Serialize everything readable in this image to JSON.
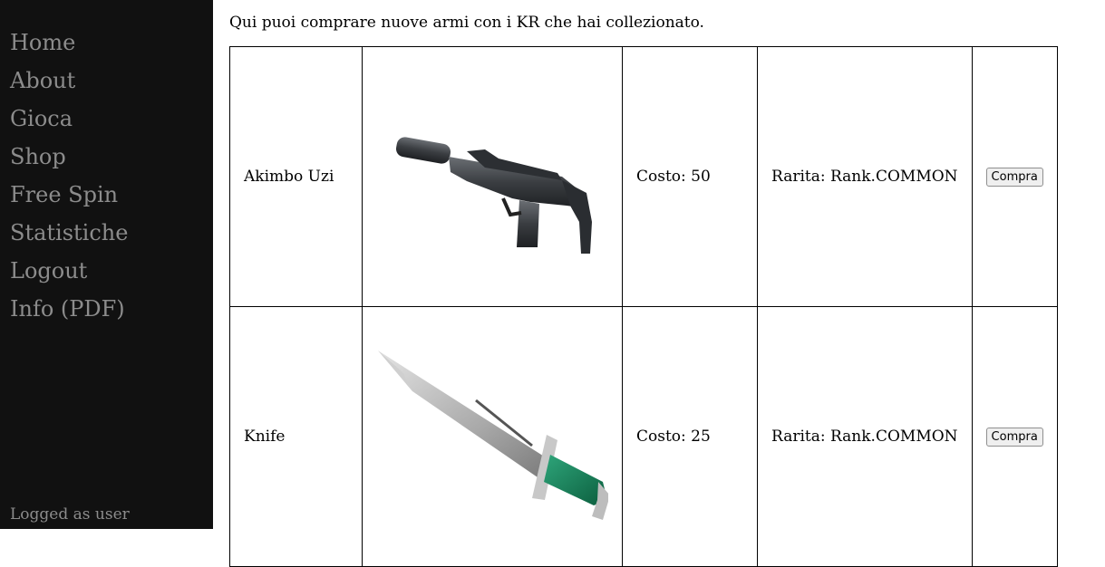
{
  "nav": {
    "items": [
      "Home",
      "About",
      "Gioca",
      "Shop",
      "Free Spin",
      "Statistiche",
      "Logout",
      "Info (PDF)"
    ],
    "logged_as": "Logged as user"
  },
  "intro": "Qui puoi comprare nuove armi con i KR che hai collezionato.",
  "weapons": [
    {
      "name": "Akimbo Uzi",
      "cost": "Costo: 50",
      "rarity": "Rarita: Rank.COMMON",
      "button": "Compra",
      "icon": "uzi-icon"
    },
    {
      "name": "Knife",
      "cost": "Costo: 25",
      "rarity": "Rarita: Rank.COMMON",
      "button": "Compra",
      "icon": "knife-icon"
    }
  ]
}
